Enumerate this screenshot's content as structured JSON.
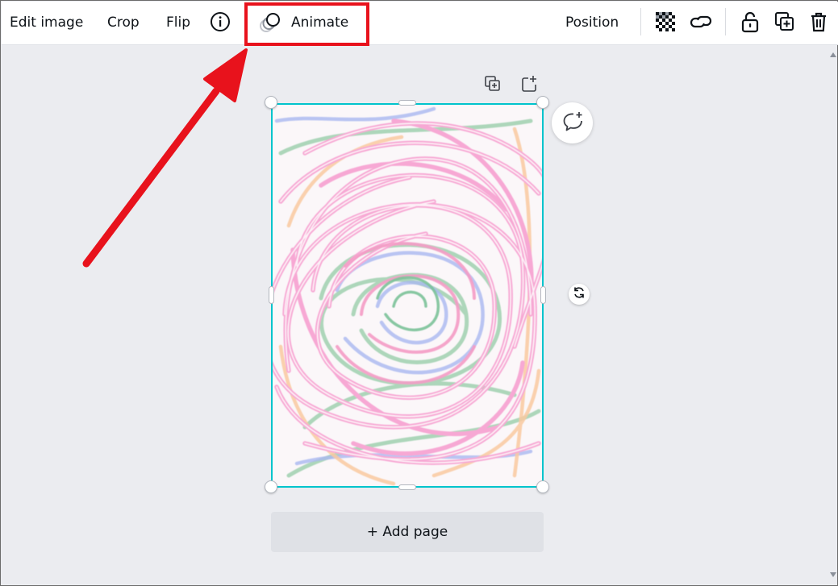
{
  "toolbar": {
    "edit_image_label": "Edit image",
    "crop_label": "Crop",
    "flip_label": "Flip",
    "animate_label": "Animate",
    "position_label": "Position",
    "icons": {
      "info": "info-icon",
      "animate": "animate-icon",
      "transparency": "transparency-icon",
      "link": "link-icon",
      "lock": "lock-icon",
      "duplicate": "duplicate-icon",
      "delete": "trash-icon"
    }
  },
  "canvas": {
    "add_page_label": "+ Add page",
    "icons": {
      "duplicate_page": "duplicate-page-icon",
      "add_page": "add-page-icon",
      "comment": "comment-add-icon",
      "rotate": "rotate-icon"
    }
  },
  "colors": {
    "selection": "#00c4cc",
    "highlight": "#e8121c",
    "canvas_bg": "#ebecf0"
  }
}
